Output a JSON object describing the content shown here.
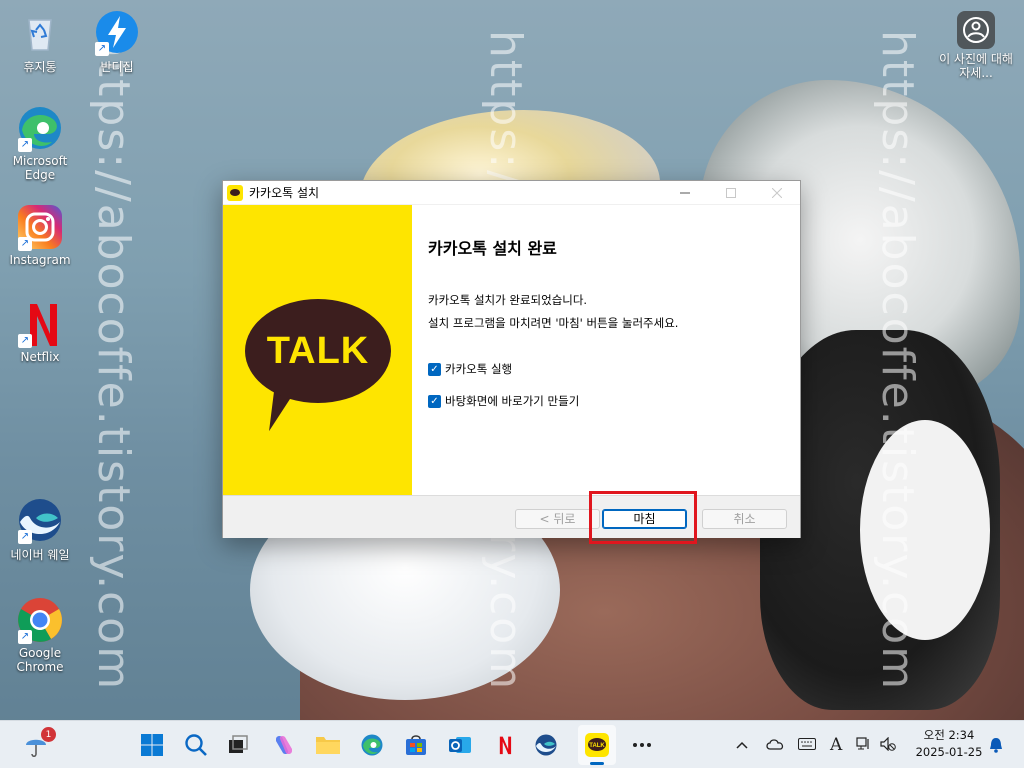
{
  "desktop": {
    "watermark": "https://abocoffe.tistory.com",
    "icons": [
      {
        "label": "휴지통"
      },
      {
        "label": "반디집"
      },
      {
        "label": "Microsoft Edge"
      },
      {
        "label": "Instagram"
      },
      {
        "label": "Netflix"
      },
      {
        "label": "네이버 웨일"
      },
      {
        "label": "Google Chrome"
      },
      {
        "label": "이 사진에 대해 자세..."
      }
    ]
  },
  "installer": {
    "window_title": "카카오톡 설치",
    "banner_logo": "TALK",
    "heading": "카카오톡 설치 완료",
    "message_line1": "카카오톡 설치가 완료되었습니다.",
    "message_line2": "설치 프로그램을 마치려면 '마침' 버튼을 눌러주세요.",
    "checkboxes": [
      {
        "label": "카카오톡 실행",
        "checked": true
      },
      {
        "label": "바탕화면에 바로가기 만들기",
        "checked": true
      }
    ],
    "buttons": {
      "back": "< 뒤로",
      "finish": "마침",
      "cancel": "취소"
    }
  },
  "taskbar": {
    "weather_badge": "1",
    "ime_indicator": "A",
    "clock": {
      "time": "오전 2:34",
      "date": "2025-01-25"
    }
  },
  "colors": {
    "kakao_yellow": "#fee500",
    "kakao_brown": "#3c1e1e",
    "highlight_red": "#e0161e",
    "accent_blue": "#0067c0"
  }
}
